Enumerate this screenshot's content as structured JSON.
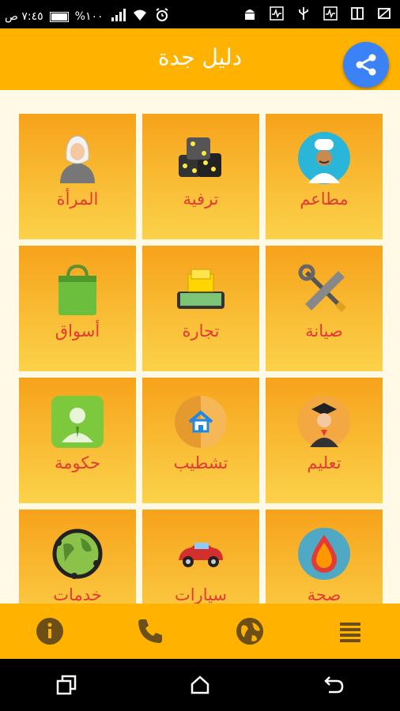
{
  "statusbar": {
    "time": "٧:٤٥ ص",
    "battery": "%١٠٠"
  },
  "appbar": {
    "title": "دليل جدة"
  },
  "tiles": [
    {
      "label": "مطاعم",
      "icon": "chef-icon"
    },
    {
      "label": "ترفية",
      "icon": "dice-icon"
    },
    {
      "label": "المرأة",
      "icon": "woman-icon"
    },
    {
      "label": "صيانة",
      "icon": "tools-icon"
    },
    {
      "label": "تجارة",
      "icon": "money-icon"
    },
    {
      "label": "أسواق",
      "icon": "shopping-bag-icon"
    },
    {
      "label": "تعليم",
      "icon": "graduate-icon"
    },
    {
      "label": "تشطيب",
      "icon": "house-icon"
    },
    {
      "label": "حكومة",
      "icon": "government-icon"
    },
    {
      "label": "صحة",
      "icon": "blood-drop-icon"
    },
    {
      "label": "سيارات",
      "icon": "car-icon"
    },
    {
      "label": "خدمات",
      "icon": "globe-network-icon"
    }
  ],
  "bottombar": {
    "items": [
      "menu-icon",
      "globe-icon",
      "phone-icon",
      "info-icon"
    ]
  }
}
